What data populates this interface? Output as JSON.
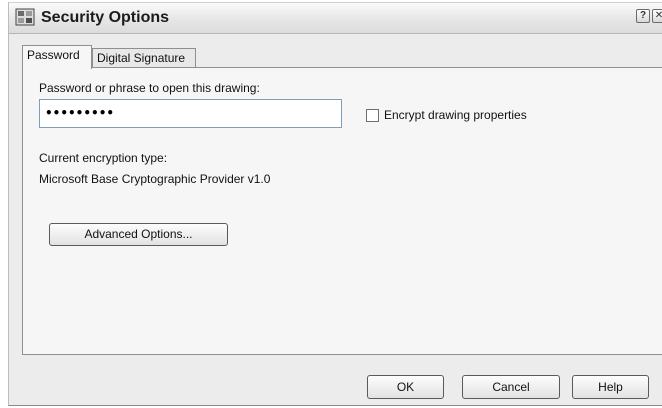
{
  "window": {
    "title": "Security Options",
    "help_glyph": "?",
    "close_glyph": "✕",
    "icon": "lock-drawing-icon"
  },
  "tabs": [
    {
      "label": "Password",
      "active": true
    },
    {
      "label": "Digital Signature",
      "active": false
    }
  ],
  "password_tab": {
    "password_label": "Password or phrase to open this drawing:",
    "password_value": "•••••••••",
    "encrypt_label": "Encrypt drawing properties",
    "encrypt_checked": false,
    "encryption_type_label": "Current encryption type:",
    "encryption_type_value": "Microsoft Base Cryptographic Provider v1.0",
    "advanced_button": "Advanced Options..."
  },
  "footer": {
    "ok": "OK",
    "cancel": "Cancel",
    "help": "Help"
  }
}
